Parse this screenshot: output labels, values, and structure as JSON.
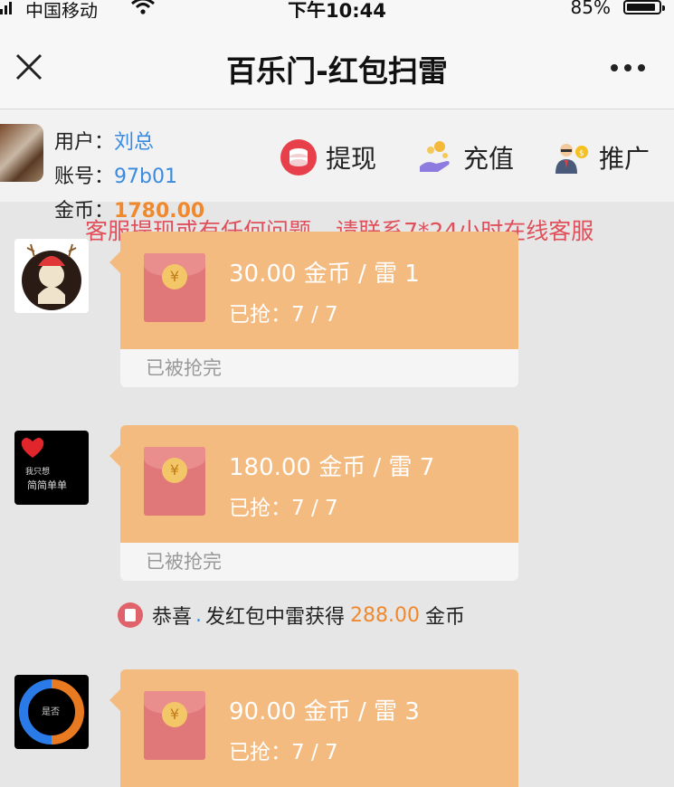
{
  "status_bar": {
    "carrier": "中国移动",
    "time": "下午10:44",
    "battery_pct": "85%",
    "battery_level": 0.85
  },
  "nav": {
    "title": "百乐门-红包扫雷",
    "close_icon": "close-icon",
    "more_icon": "more-icon"
  },
  "user": {
    "user_label": "用户：",
    "user_name": "刘总",
    "account_label": "账号：",
    "account_id": "97b01",
    "coins_label": "金币：",
    "coins": "1780.00"
  },
  "actions": [
    {
      "label": "提现",
      "icon": "withdraw-coins-icon"
    },
    {
      "label": "充值",
      "icon": "recharge-hand-icon"
    },
    {
      "label": "推广",
      "icon": "promoter-icon"
    }
  ],
  "notice": "客服提现或有任何问题---请联系7*24小时在线客服",
  "messages": [
    {
      "amount": "30.00 金币 / 雷 1",
      "grabbed": "已抢：7 / 7",
      "status": "已被抢完",
      "coin_symbol": "¥"
    },
    {
      "amount": "180.00 金币 / 雷 7",
      "grabbed": "已抢：7 / 7",
      "status": "已被抢完",
      "coin_symbol": "¥",
      "avatar_text_top": "我只想",
      "avatar_text_bottom": "简简单单"
    },
    {
      "amount": "90.00 金币 / 雷 3",
      "grabbed": "已抢：7 / 7",
      "coin_symbol": "¥",
      "avatar_text": "是否"
    }
  ],
  "system_message": {
    "prefix": "恭喜",
    "dot": ".",
    "middle": "发红包中雷获得",
    "amount": "288.00",
    "suffix": "金币"
  }
}
